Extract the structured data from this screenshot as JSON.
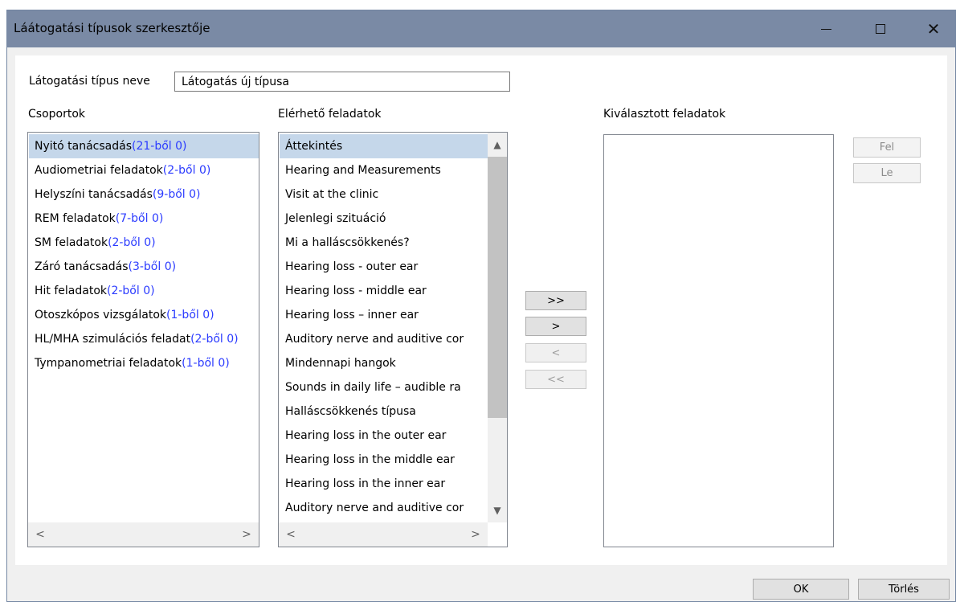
{
  "window": {
    "title": "Láátogatási típusok szerkesztője"
  },
  "form": {
    "name_label": "Látogatási típus neve",
    "name_value": "Látogatás új típusa"
  },
  "groups": {
    "header": "Csoportok",
    "items": [
      {
        "label": "Nyitó tanácsadás",
        "count": "(21-ből 0)"
      },
      {
        "label": "Audiometriai feladatok",
        "count": "(2-ből 0)"
      },
      {
        "label": "Helyszíni tanácsadás",
        "count": "(9-ből 0)"
      },
      {
        "label": "REM feladatok",
        "count": "(7-ből 0)"
      },
      {
        "label": "SM feladatok",
        "count": "(2-ből 0)"
      },
      {
        "label": "Záró tanácsadás",
        "count": "(3-ből 0)"
      },
      {
        "label": "Hit feladatok",
        "count": "(2-ből 0)"
      },
      {
        "label": "Otoszkópos vizsgálatok",
        "count": "(1-ből 0)"
      },
      {
        "label": "HL/MHA szimulációs feladat",
        "count": "(2-ből 0)"
      },
      {
        "label": "Tympanometriai feladatok",
        "count": "(1-ből 0)"
      }
    ]
  },
  "available": {
    "header": "Elérhető feladatok",
    "items": [
      "Áttekintés",
      "Hearing and Measurements",
      "Visit at the clinic",
      "Jelenlegi szituáció",
      "Mi a halláscsökkenés?",
      "Hearing loss - outer ear",
      "Hearing loss - middle ear",
      "Hearing loss – inner ear",
      "Auditory nerve and auditive cor",
      "Mindennapi hangok",
      "Sounds in daily life – audible ra",
      "Halláscsökkenés típusa",
      "Hearing loss in the outer ear",
      "Hearing loss in the middle ear",
      "Hearing loss in the inner ear",
      "Auditory nerve and auditive cor"
    ]
  },
  "selected": {
    "header": "Kiválasztott feladatok"
  },
  "transfer": {
    "add_all": ">>",
    "add": ">",
    "remove": "<",
    "remove_all": "<<"
  },
  "order": {
    "up": "Fel",
    "down": "Le"
  },
  "footer": {
    "ok": "OK",
    "delete": "Törlés"
  }
}
